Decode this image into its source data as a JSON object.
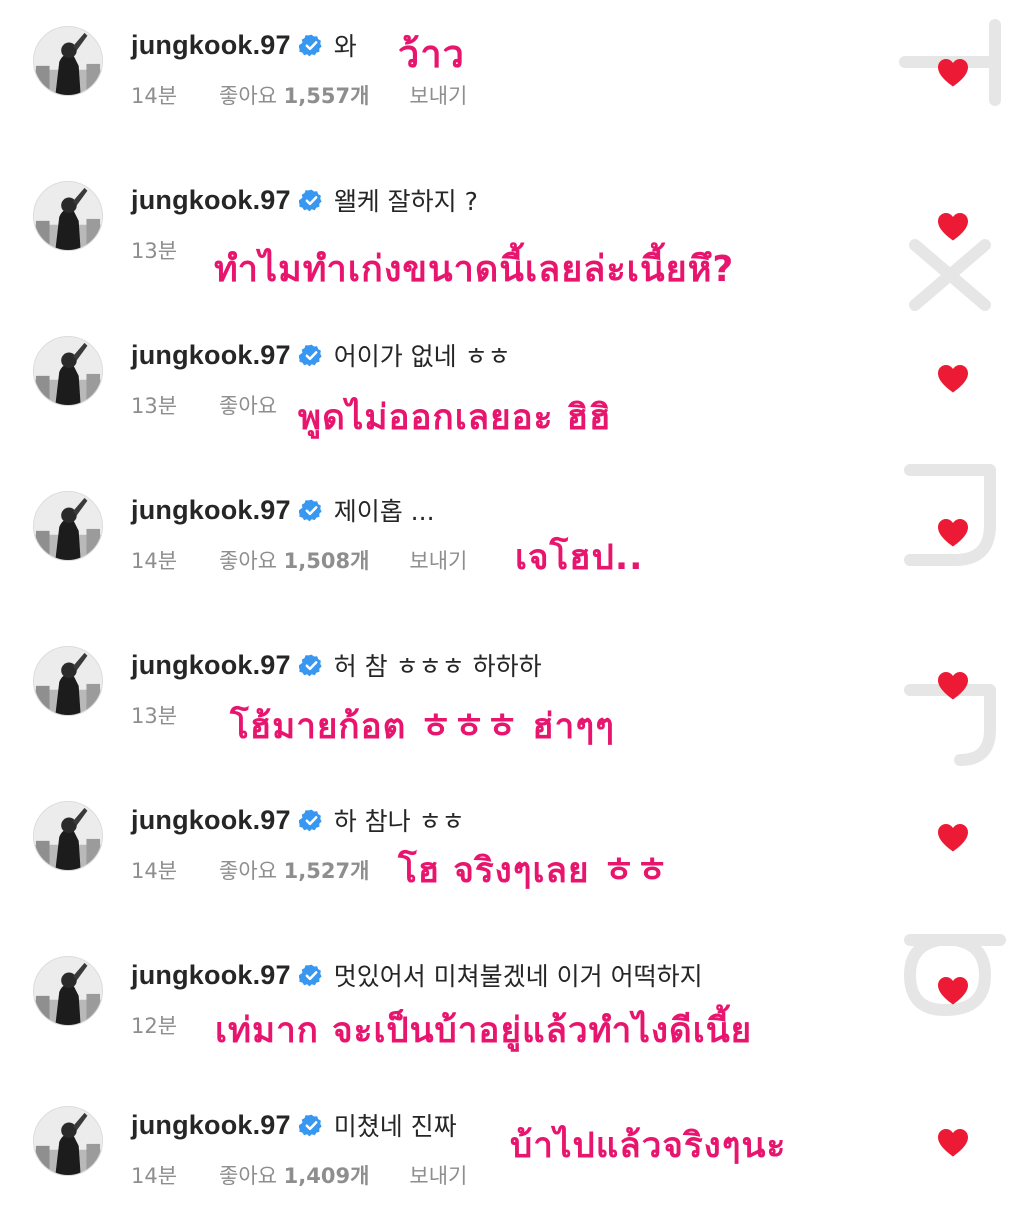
{
  "watermark": {
    "letters": [
      "T",
      "x",
      "n",
      "r",
      "p"
    ]
  },
  "colors": {
    "verified": "#3897f0",
    "heart": "#ed1a35",
    "translation": "#e8156e"
  },
  "comments": [
    {
      "username": "jungkook.97",
      "text": "와",
      "time": "14분",
      "likes_label": "좋아요",
      "likes_count": "1,557개",
      "reply": "보내기",
      "translation": "ว้าว"
    },
    {
      "username": "jungkook.97",
      "text": "왤케 잘하지 ?",
      "time": "13분",
      "likes_label": "",
      "likes_count": "",
      "reply": "",
      "translation": "ทำไมทำเก่งขนาดนี้เลยล่ะเนี้ยหึ?"
    },
    {
      "username": "jungkook.97",
      "text": "어이가 없네 ㅎㅎ",
      "time": "13분",
      "likes_label": "좋아요",
      "likes_count": "",
      "reply": "",
      "translation": "พูดไม่ออกเลยอะ ฮิฮิ"
    },
    {
      "username": "jungkook.97",
      "text": "제이홉 ...",
      "time": "14분",
      "likes_label": "좋아요",
      "likes_count": "1,508개",
      "reply": "보내기",
      "translation": "เจโฮป.."
    },
    {
      "username": "jungkook.97",
      "text": "허 참 ㅎㅎㅎ 하하하",
      "time": "13분",
      "likes_label": "",
      "likes_count": "",
      "reply": "",
      "translation": "โฮ้มายก้อต ㅎㅎㅎ ฮ่าๆๆ"
    },
    {
      "username": "jungkook.97",
      "text": "하 참나 ㅎㅎ",
      "time": "14분",
      "likes_label": "좋아요",
      "likes_count": "1,527개",
      "reply": "",
      "translation": "โฮ จริงๆเลย ㅎㅎ"
    },
    {
      "username": "jungkook.97",
      "text": "멋있어서 미쳐불겠네 이거 어떡하지",
      "time": "12분",
      "likes_label": "",
      "likes_count": "",
      "reply": "",
      "translation": "เท่มาก จะเป็นบ้าอยู่แล้วทำไงดีเนี้ย"
    },
    {
      "username": "jungkook.97",
      "text": "미쳤네 진짜",
      "time": "14분",
      "likes_label": "좋아요",
      "likes_count": "1,409개",
      "reply": "보내기",
      "translation": "บ้าไปแล้วจริงๆนะ"
    }
  ]
}
